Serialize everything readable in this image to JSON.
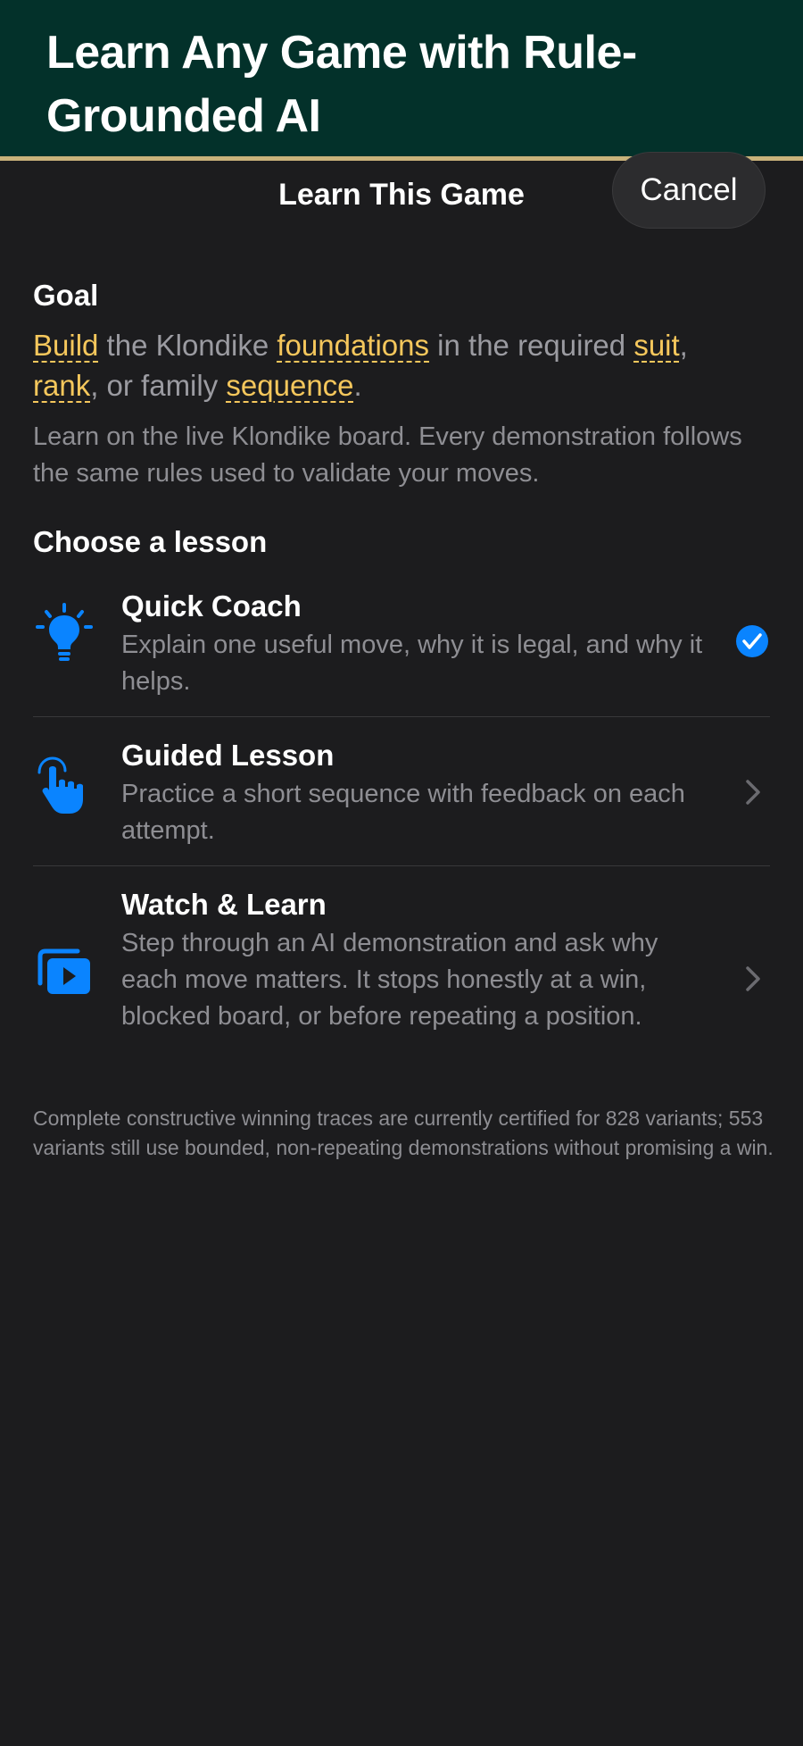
{
  "banner": {
    "title": "Learn Any Game with Rule-Grounded AI"
  },
  "nav": {
    "title": "Learn This Game",
    "cancel_label": "Cancel"
  },
  "goal": {
    "heading": "Goal",
    "term_build": "Build",
    "text_1": " the Klondike ",
    "term_foundations": "foundations",
    "text_2": " in the required ",
    "term_suit": "suit",
    "text_3": ",",
    "term_rank": "rank",
    "text_4": ", or family ",
    "term_sequence": "sequence",
    "text_5": ".",
    "intro": "Learn on the live Klondike board. Every demonstration follows the same rules used to validate your moves."
  },
  "lessons": {
    "heading": "Choose a lesson",
    "items": [
      {
        "title": "Quick Coach",
        "description": "Explain one useful move, why it is legal, and why it helps.",
        "icon": "lightbulb-icon",
        "selected": true
      },
      {
        "title": "Guided Lesson",
        "description": "Practice a short sequence with feedback on each attempt.",
        "icon": "hand-tap-icon",
        "selected": false
      },
      {
        "title": "Watch & Learn",
        "description": "Step through an AI demonstration and ask why each move matters. It stops honestly at a win, blocked board, or before repeating a position.",
        "icon": "play-stack-icon",
        "selected": false
      }
    ]
  },
  "footnote": "Complete constructive winning traces are currently certified for 828 variants; 553 variants still use bounded, non-repeating demonstrations without promising a win.",
  "colors": {
    "banner_bg": "#03312a",
    "banner_border": "#c9b27a",
    "sheet_bg": "#1c1c1e",
    "accent_blue": "#0a84ff",
    "term_gold": "#f5c75c"
  }
}
